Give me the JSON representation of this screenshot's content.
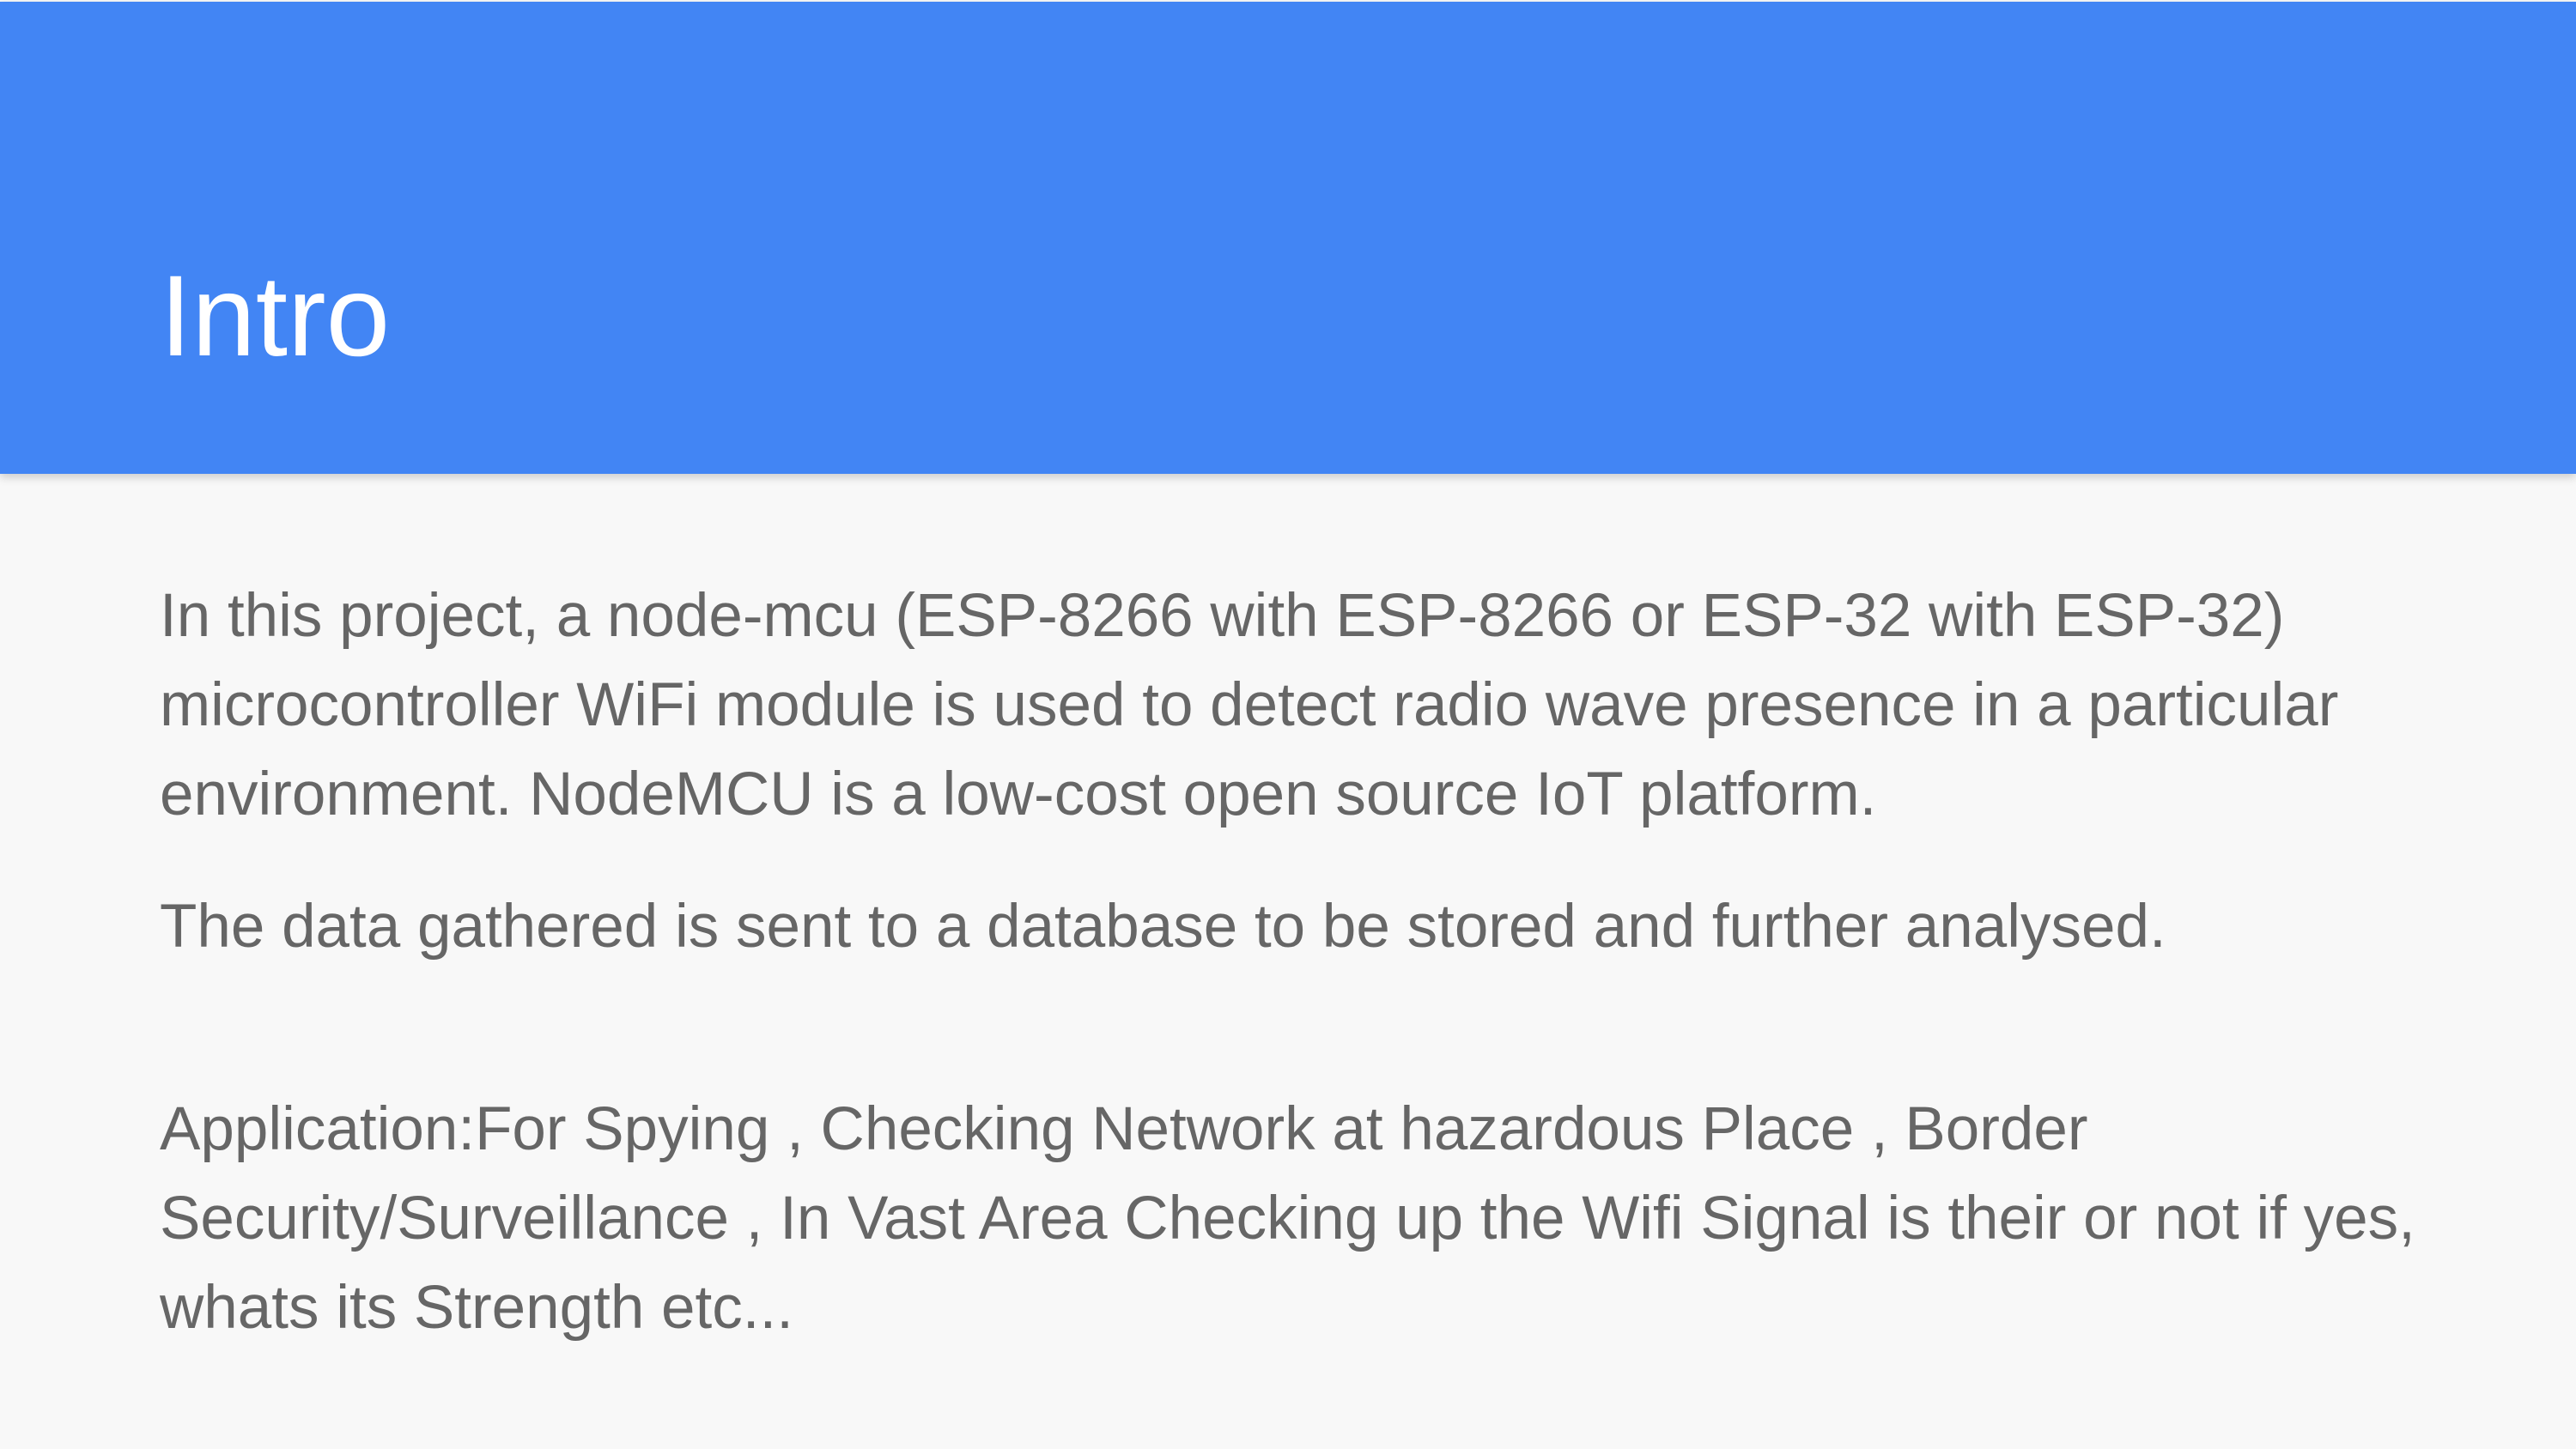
{
  "slide": {
    "title": "Intro",
    "paragraphs": [
      "In this project, a node-mcu (ESP-8266 with ESP-8266 or ESP-32 with ESP-32) microcontroller WiFi module is used to detect radio wave presence in a particular environment. NodeMCU is a low-cost open source IoT platform.",
      "The data gathered is sent to a database to be stored and further analysed.",
      "Application:For Spying , Checking Network at hazardous Place , Border Security/Surveillance , In Vast Area Checking up the Wifi Signal is their or not if yes, whats its Strength etc..."
    ]
  },
  "colors": {
    "header_band": "#4285f4",
    "title_text": "#ffffff",
    "body_text": "#666666",
    "background": "#f8f8f8"
  }
}
